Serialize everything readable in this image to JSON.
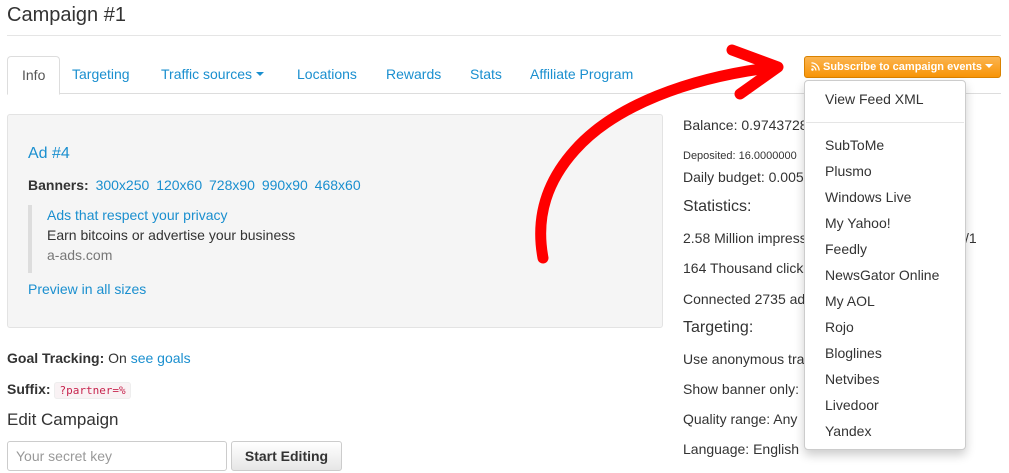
{
  "page": {
    "title": "Campaign #1"
  },
  "tabs": [
    {
      "label": "Info"
    },
    {
      "label": "Targeting"
    },
    {
      "label": "Traffic sources"
    },
    {
      "label": "Locations"
    },
    {
      "label": "Rewards"
    },
    {
      "label": "Stats"
    },
    {
      "label": "Affiliate Program"
    }
  ],
  "ad": {
    "title": "Ad #4",
    "banners_label": "Banners:",
    "banner_sizes": [
      "300x250",
      "120x60",
      "728x90",
      "990x90",
      "468x60"
    ],
    "quote_link": "Ads that respect your privacy",
    "quote_text": "Earn bitcoins or advertise your business",
    "quote_source": "a-ads.com",
    "preview_link": "Preview in all sizes"
  },
  "goal_tracking": {
    "label": "Goal Tracking:",
    "value": "On",
    "link": "see goals"
  },
  "suffix": {
    "label": "Suffix:",
    "value": "?partner=%"
  },
  "edit": {
    "heading": "Edit Campaign",
    "secret_placeholder": "Your secret key",
    "start_button": "Start Editing"
  },
  "stats": {
    "balance": "Balance: 0.9743728",
    "deposited": "Deposited: 16.0000000",
    "daily_budget": "Daily budget: 0.005",
    "statistics_heading": "Statistics:",
    "impressions": "2.58 Million impress",
    "impressions_tail": "/1",
    "clicks": "164 Thousand click",
    "connected": "Connected 2735 ad",
    "targeting_heading": "Targeting:",
    "anonymous": "Use anonymous tra",
    "show_banner": "Show banner only:",
    "quality": "Quality range: Any",
    "language": "Language: English"
  },
  "subscribe": {
    "button_label": "Subscribe to campaign events",
    "view_feed": "View Feed XML",
    "readers": [
      "SubToMe",
      "Plusmo",
      "Windows Live",
      "My Yahoo!",
      "Feedly",
      "NewsGator Online",
      "My AOL",
      "Rojo",
      "Bloglines",
      "Netvibes",
      "Livedoor",
      "Yandex"
    ]
  },
  "colors": {
    "link": "#1a8fcf",
    "subscribe_button": "#f89406",
    "annotation_arrow": "#ff0000"
  },
  "icons": [
    "rss-icon",
    "chevron-down-icon"
  ]
}
